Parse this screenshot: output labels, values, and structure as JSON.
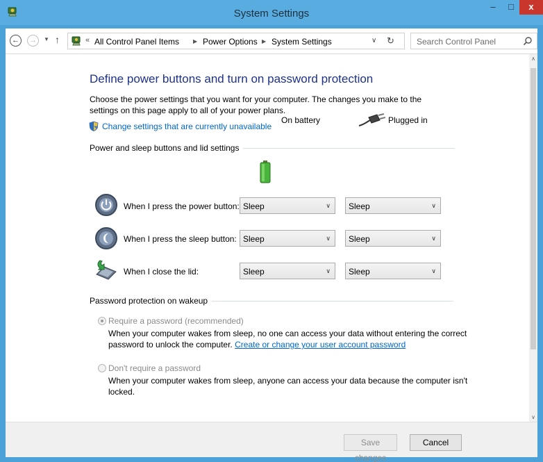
{
  "window": {
    "title": "System Settings",
    "minimize_glyph": "–",
    "maximize_glyph": "□",
    "close_glyph": "x",
    "app_icon": "power-options-icon"
  },
  "nav": {
    "back_glyph": "←",
    "forward_glyph": "→",
    "recent_glyph": "▼",
    "up_glyph": "↑",
    "address_chevron": "«",
    "breadcrumbs": [
      "All Control Panel Items",
      "Power Options",
      "System Settings"
    ],
    "crumb_sep": "▶",
    "address_drop_glyph": "∨",
    "refresh_glyph": "↻",
    "search_placeholder": "Search Control Panel"
  },
  "scrollbar": {
    "up_glyph": "∧",
    "down_glyph": "∨"
  },
  "page": {
    "heading": "Define power buttons and turn on password protection",
    "description": "Choose the power settings that you want for your computer. The changes you make to the settings on this page apply to all of your power plans.",
    "change_settings_link": "Change settings that are currently unavailable"
  },
  "buttons_section": {
    "title": "Power and sleep buttons and lid settings",
    "col_battery": "On battery",
    "col_plugged": "Plugged in",
    "select_chevron": "∨",
    "rows": [
      {
        "label": "When I press the power button:",
        "battery": "Sleep",
        "plugged": "Sleep",
        "icon": "power-button-icon"
      },
      {
        "label": "When I press the sleep button:",
        "battery": "Sleep",
        "plugged": "Sleep",
        "icon": "sleep-button-icon"
      },
      {
        "label": "When I close the lid:",
        "battery": "Sleep",
        "plugged": "Sleep",
        "icon": "laptop-lid-icon"
      }
    ]
  },
  "password_section": {
    "title": "Password protection on wakeup",
    "require_label": "Require a password (recommended)",
    "require_desc": "When your computer wakes from sleep, no one can access your data without entering the correct password to unlock the computer.",
    "require_link": "Create or change your user account password",
    "require_checked": true,
    "no_require_label": "Don't require a password",
    "no_require_desc": "When your computer wakes from sleep, anyone can access your data because the computer isn't locked.",
    "no_require_checked": false
  },
  "footer": {
    "save_label": "Save changes",
    "cancel_label": "Cancel"
  },
  "colors": {
    "titlebar": "#58ace0",
    "heading": "#1e3287",
    "link": "#0066cc",
    "close": "#c9372c"
  }
}
